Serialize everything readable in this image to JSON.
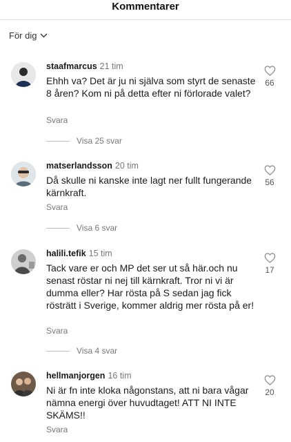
{
  "header": {
    "title": "Kommentarer"
  },
  "filter": {
    "label": "För dig"
  },
  "comments": [
    {
      "username": "staafmarcus",
      "time": "21 tim",
      "text": "Ehhh va? Det är ju ni själva som styrt de senaste 8 åren? Kom ni på detta efter ni förlorade valet?",
      "reply_label": "Svara",
      "view_replies": "Visa 25 svar",
      "likes": "66"
    },
    {
      "username": "matserlandsson",
      "time": "20 tim",
      "text": "Då skulle ni kanske inte lagt ner fullt fungerande kärnkraft.",
      "reply_label": "Svara",
      "view_replies": "Visa 6 svar",
      "likes": "56"
    },
    {
      "username": "halili.tefik",
      "time": "15 tim",
      "text": "Tack vare er och MP det ser ut så här.och nu senast röstar ni nej till kärnkraft. Tror ni vi är dumma eller? Har rösta på S sedan jag fick rösträtt i Sverige, kommer aldrig mer rösta på er!",
      "reply_label": "Svara",
      "view_replies": "Visa 4 svar",
      "likes": "17"
    },
    {
      "username": "hellmanjorgen",
      "time": "16 tim",
      "text": "Ni är fn inte kloka någonstans, att ni bara vågar nämna energi över huvudtaget! ATT NI INTE SKÄMS!!",
      "reply_label": "Svara",
      "likes": "20"
    }
  ],
  "icons": {
    "like": "heart-outline-icon",
    "filter": "chevron-down-icon"
  }
}
